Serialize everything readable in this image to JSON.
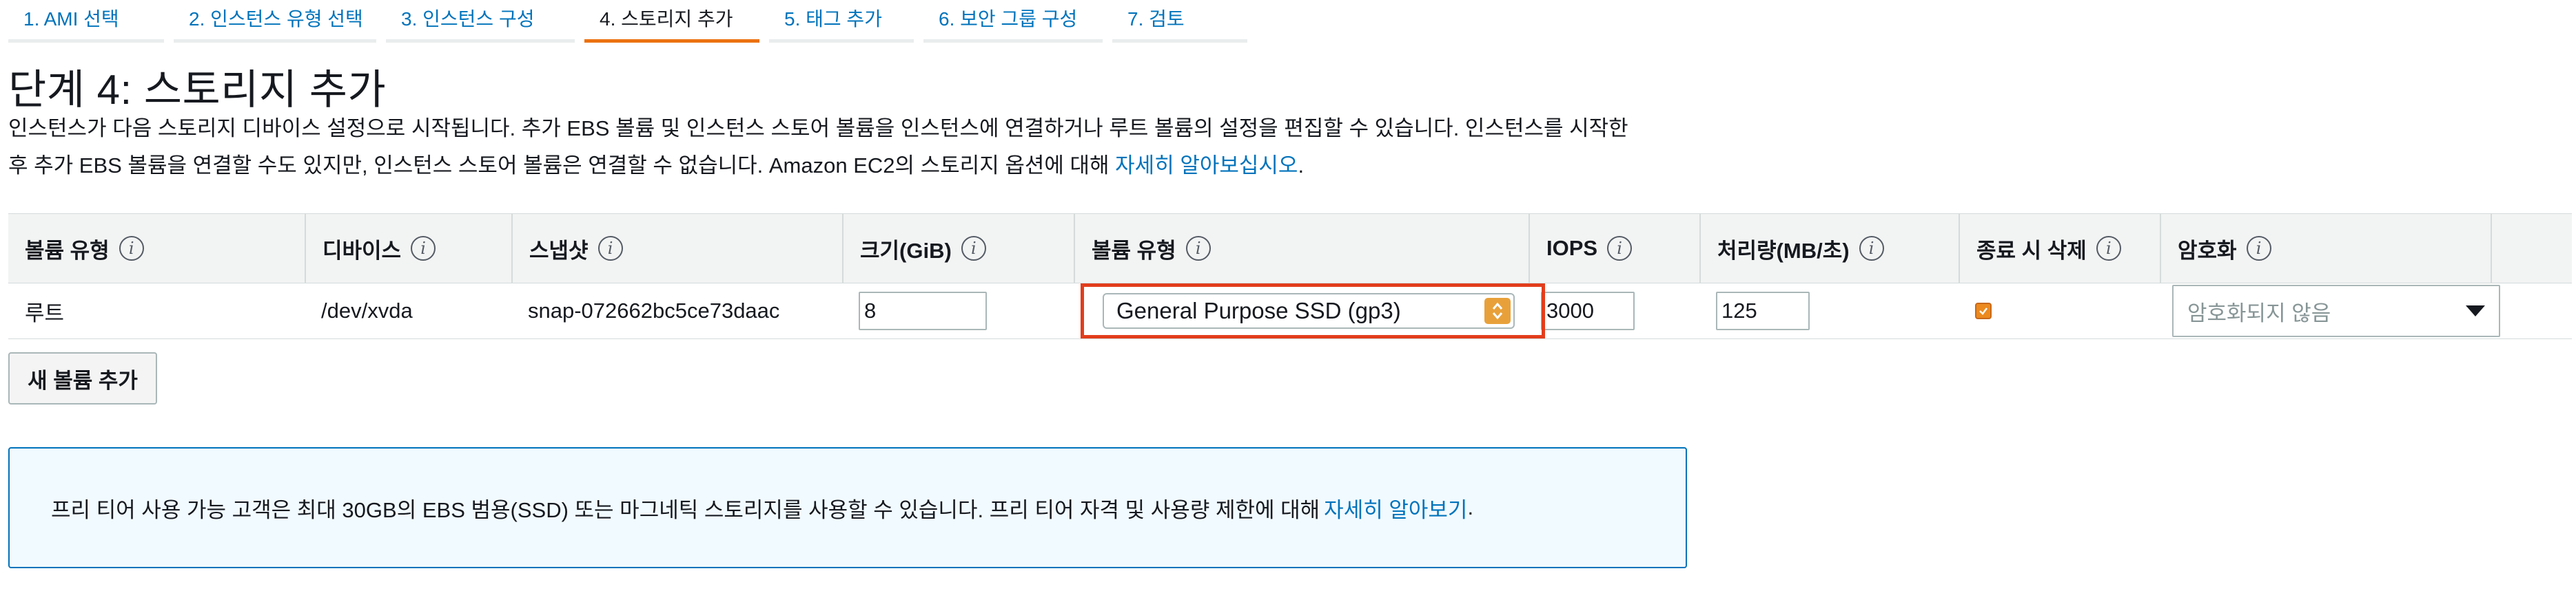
{
  "steps": [
    {
      "label": "1. AMI 선택",
      "active": false
    },
    {
      "label": "2. 인스턴스 유형 선택",
      "active": false
    },
    {
      "label": "3. 인스턴스 구성",
      "active": false
    },
    {
      "label": "4. 스토리지 추가",
      "active": true
    },
    {
      "label": "5. 태그 추가",
      "active": false
    },
    {
      "label": "6. 보안 그룹 구성",
      "active": false
    },
    {
      "label": "7. 검토",
      "active": false
    }
  ],
  "page": {
    "title": "단계 4: 스토리지 추가",
    "description_line1": "인스턴스가 다음 스토리지 디바이스 설정으로 시작됩니다. 추가 EBS 볼륨 및 인스턴스 스토어 볼륨을 인스턴스에 연결하거나 루트 볼륨의 설정을 편집할 수 있습니다. 인스턴스를 시작한",
    "description_line2": "후 추가 EBS 볼륨을 연결할 수도 있지만, 인스턴스 스토어 볼륨은 연결할 수 없습니다. Amazon EC2의 스토리지 옵션에 대해 ",
    "learn_more_link": "자세히 알아보십시오",
    "description_end": "."
  },
  "table": {
    "headers": {
      "volume_type": "볼륨 유형",
      "device": "디바이스",
      "snapshot": "스냅샷",
      "size": "크기(GiB)",
      "ebs_type": "볼륨 유형",
      "iops": "IOPS",
      "throughput": "처리량(MB/초)",
      "delete_on_termination": "종료 시 삭제",
      "encryption": "암호화"
    },
    "row": {
      "volume_type": "루트",
      "device": "/dev/xvda",
      "snapshot": "snap-072662bc5ce73daac",
      "size": "8",
      "ebs_type": "General Purpose SSD (gp3)",
      "iops": "3000",
      "throughput": "125",
      "delete_on_termination": true,
      "encryption": "암호화되지 않음"
    }
  },
  "add_volume_button": "새 볼륨 추가",
  "banner": {
    "text": "프리 티어 사용 가능 고객은 최대 30GB의 EBS 범용(SSD) 또는 마그네틱 스토리지를 사용할 수 있습니다. 프리 티어 자격 및 사용량 제한에 대해 ",
    "link": "자세히 알아보기",
    "end": "."
  },
  "info_symbol": "i",
  "colors": {
    "link": "#0073bb",
    "active_step": "#ec7211",
    "highlight": "#e23d1c",
    "checkbox": "#ec8a1e"
  }
}
